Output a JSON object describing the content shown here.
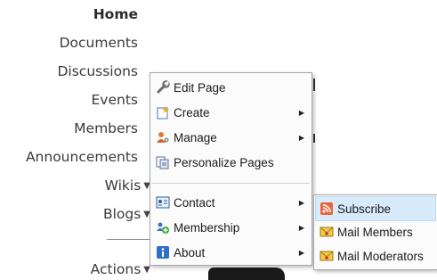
{
  "nav": {
    "items": [
      {
        "label": "Home",
        "bold": true
      },
      {
        "label": "Documents"
      },
      {
        "label": "Discussions"
      },
      {
        "label": "Events"
      },
      {
        "label": "Members"
      },
      {
        "label": "Announcements"
      },
      {
        "label": "Wikis",
        "caret": true
      },
      {
        "label": "Blogs",
        "caret": true
      },
      {
        "label": "Actions",
        "caret": true
      }
    ]
  },
  "menu": {
    "items": [
      {
        "label": "Edit Page",
        "icon": "wrench-icon"
      },
      {
        "label": "Create",
        "icon": "new-page-icon",
        "submenu": true
      },
      {
        "label": "Manage",
        "icon": "users-gear-icon",
        "submenu": true
      },
      {
        "label": "Personalize Pages",
        "icon": "personalize-icon"
      },
      {
        "label": "Contact",
        "icon": "contact-card-icon",
        "submenu": true
      },
      {
        "label": "Membership",
        "icon": "membership-icon",
        "submenu": true
      },
      {
        "label": "About",
        "icon": "info-icon",
        "submenu": true
      }
    ]
  },
  "submenu": {
    "items": [
      {
        "label": "Subscribe",
        "icon": "rss-icon",
        "highlighted": true
      },
      {
        "label": "Mail Members",
        "icon": "mail-icon"
      },
      {
        "label": "Mail Moderators",
        "icon": "mail-icon"
      }
    ]
  },
  "colors": {
    "highlight": "#d8ebfb",
    "menu_border": "#a8a8a8"
  }
}
